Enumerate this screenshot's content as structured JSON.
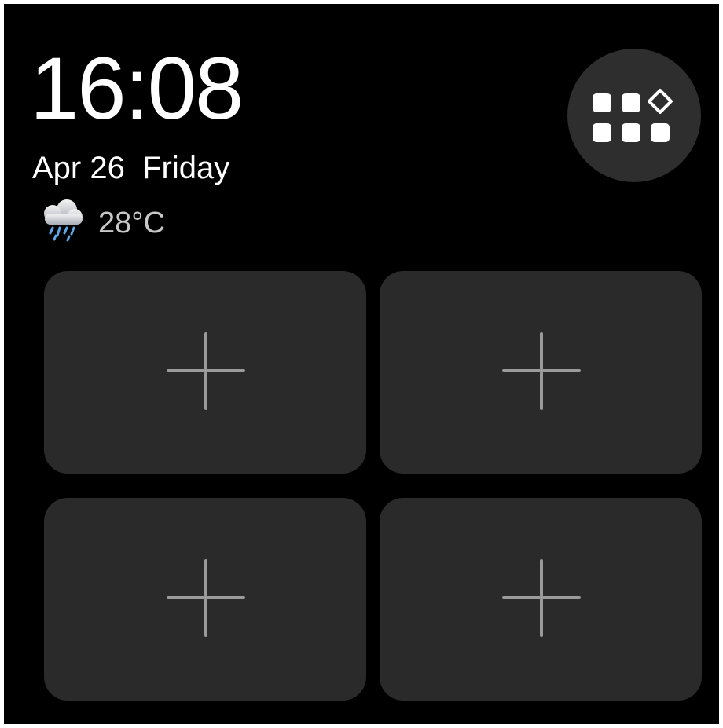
{
  "status": {
    "time": "16:08",
    "date": "Apr 26  Friday"
  },
  "weather": {
    "icon": "rain-cloud-icon",
    "temperature": "28°C"
  },
  "apps_button": {
    "icon": "app-grid-icon"
  },
  "widget_slots": [
    {
      "icon": "plus-icon",
      "state": "empty"
    },
    {
      "icon": "plus-icon",
      "state": "empty"
    },
    {
      "icon": "plus-icon",
      "state": "empty"
    },
    {
      "icon": "plus-icon",
      "state": "empty"
    }
  ],
  "colors": {
    "background": "#000000",
    "tile": "#2a2a2a",
    "apps_button": "#2e2e2e",
    "plus": "#9a9a9a",
    "text_primary": "#ffffff",
    "text_secondary": "#c8c8c8"
  }
}
